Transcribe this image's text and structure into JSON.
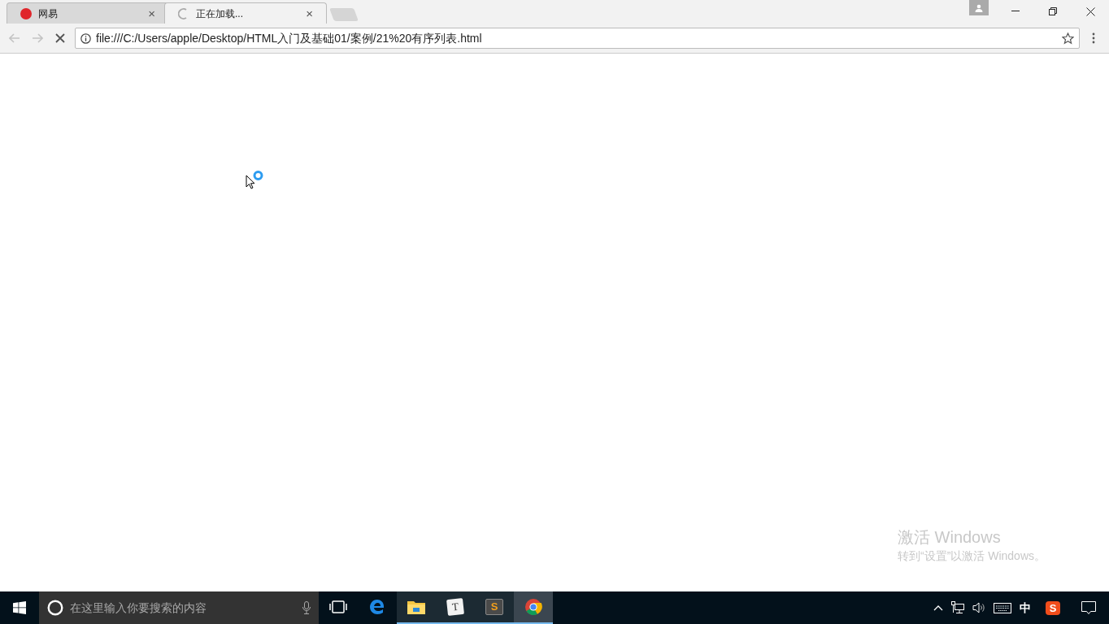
{
  "tabs": [
    {
      "title": "网易",
      "selected": false,
      "loading": false,
      "close": "×"
    },
    {
      "title": "正在加载...",
      "selected": true,
      "loading": true,
      "close": "×"
    }
  ],
  "address_bar": {
    "url": "file:///C:/Users/apple/Desktop/HTML入门及基础01/案例/21%20有序列表.html",
    "back_disabled": true,
    "forward_disabled": true
  },
  "activation_notice": {
    "title": "激活 Windows",
    "message": "转到“设置”以激活 Windows。"
  },
  "taskbar": {
    "search": {
      "placeholder": "在这里输入你要搜索的内容"
    },
    "apps": [
      {
        "kind": "task-view",
        "running": false,
        "selected": false
      },
      {
        "kind": "edge",
        "running": false,
        "selected": false
      },
      {
        "kind": "explorer",
        "running": true,
        "selected": false
      },
      {
        "kind": "typora",
        "glyph": "T",
        "running": true,
        "selected": false
      },
      {
        "kind": "sublime",
        "glyph": "S",
        "running": true,
        "selected": false
      },
      {
        "kind": "chrome",
        "running": true,
        "selected": true
      }
    ],
    "tray": {
      "ime": "中",
      "sogou": "S"
    }
  }
}
